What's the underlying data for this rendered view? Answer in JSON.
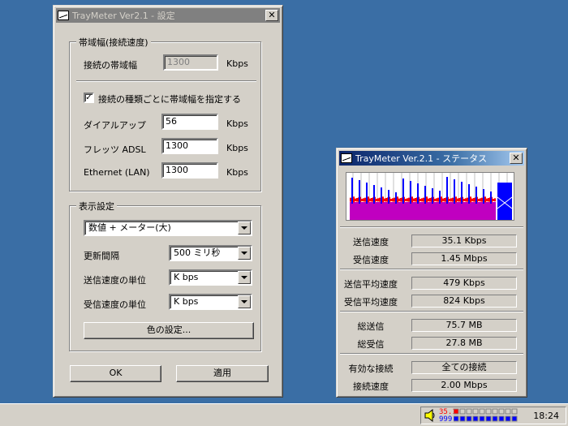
{
  "settings": {
    "title": "TrayMeter Ver2.1 - 設定",
    "bandwidth_group": "帯域幅(接続速度)",
    "conn_bandwidth_label": "接続の帯域幅",
    "conn_bandwidth_value": "1300",
    "conn_bandwidth_unit": "Kbps",
    "per_type_checkbox_label": "接続の種類ごとに帯域幅を指定する",
    "per_type_checked": true,
    "dialup_label": "ダイアルアップ",
    "dialup_value": "56",
    "dialup_unit": "Kbps",
    "flets_label": "フレッツ ADSL",
    "flets_value": "1300",
    "flets_unit": "Kbps",
    "ethernet_label": "Ethernet (LAN)",
    "ethernet_value": "1300",
    "ethernet_unit": "Kbps",
    "display_group": "表示設定",
    "display_mode": "数値 + メーター(大)",
    "interval_label": "更新間隔",
    "interval_value": "500 ミリ秒",
    "send_unit_label": "送信速度の単位",
    "send_unit_value": "K bps",
    "recv_unit_label": "受信速度の単位",
    "recv_unit_value": "K bps",
    "color_button": "色の設定...",
    "ok_button": "OK",
    "apply_button": "適用"
  },
  "status": {
    "title": "TrayMeter Ver.2.1 - ステータス",
    "rows": [
      {
        "label": "送信速度",
        "value": "35.1 Kbps"
      },
      {
        "label": "受信速度",
        "value": "1.45 Mbps"
      },
      {
        "label": "送信平均速度",
        "value": "479 Kbps"
      },
      {
        "label": "受信平均速度",
        "value": "824 Kbps"
      },
      {
        "label": "総送信",
        "value": "75.7 MB"
      },
      {
        "label": "総受信",
        "value": "27.8 MB"
      },
      {
        "label": "有効な接続",
        "value": "全ての接続"
      },
      {
        "label": "接続速度",
        "value": "2.00 Mbps"
      }
    ]
  },
  "taskbar": {
    "tray_send": "35.1",
    "tray_recv": "999",
    "clock": "18:24"
  },
  "colors": {
    "desktop": "#3a6ea5",
    "graph_send": "#ff0000",
    "graph_recv": "#0000ff",
    "graph_fill": "#c000c0"
  }
}
